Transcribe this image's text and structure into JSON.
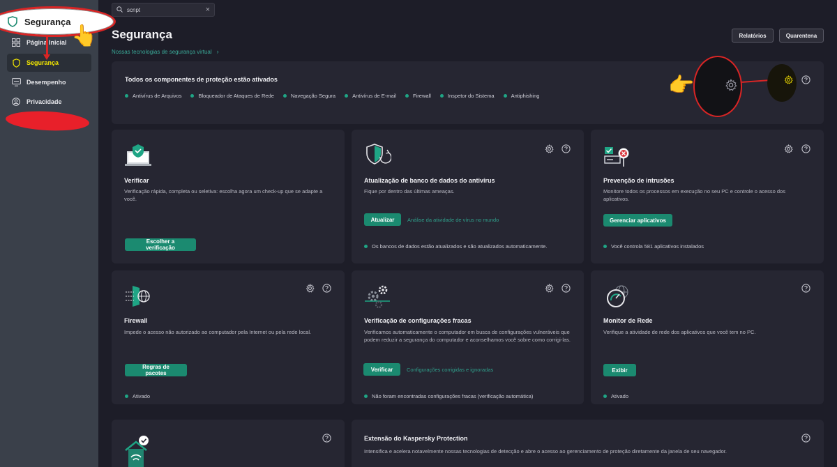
{
  "sidebar": {
    "items": [
      {
        "label": "Página Inicial",
        "icon": "grid-icon"
      },
      {
        "label": "Segurança",
        "icon": "shield-icon",
        "active": true
      },
      {
        "label": "Desempenho",
        "icon": "monitor-icon"
      },
      {
        "label": "Privacidade",
        "icon": "privacy-icon"
      }
    ]
  },
  "brand": {
    "label": "Segurança"
  },
  "search": {
    "query": "scnpt"
  },
  "header": {
    "title": "Segurança",
    "subtitle_link": "Nossas tecnologias de segurança virtual",
    "reports_label": "Relatórios",
    "quarantine_label": "Quarentena"
  },
  "protection": {
    "title": "Todos os componentes de proteção estão ativados",
    "components": [
      "Antivírus de Arquivos",
      "Bloqueador de Ataques de Rede",
      "Navegação Segura",
      "Antivírus de E-mail",
      "Firewall",
      "Inspetor do Sistema",
      "Antiphishing"
    ]
  },
  "cards": {
    "scan": {
      "title": "Verificar",
      "desc": "Verificação rápida, completa ou seletiva: escolha agora um check-up que se adapte a você.",
      "button": "Escolher a verificação"
    },
    "update": {
      "title": "Atualização de banco de dados do antivírus",
      "desc": "Fique por dentro das últimas ameaças.",
      "button": "Atualizar",
      "link": "Análise da atividade de vírus no mundo",
      "status": "Os bancos de dados estão atualizados e são atualizados automaticamente."
    },
    "intrusion": {
      "title": "Prevenção de intrusões",
      "desc": "Monitore todos os processos em execução no seu PC e controle o acesso dos aplicativos.",
      "button": "Gerenciar aplicativos",
      "status": "Você controla 581 aplicativos instalados"
    },
    "firewall": {
      "title": "Firewall",
      "desc": "Impede o acesso não autorizado ao computador pela Internet ou pela rede local.",
      "button": "Regras de pacotes",
      "status": "Ativado"
    },
    "weak": {
      "title": "Verificação de configurações fracas",
      "desc": "Verificamos automaticamente o computador em busca de configurações vulneráveis que podem reduzir a segurança do computador e aconselhamos você sobre como corrigi-las.",
      "button": "Verificar",
      "link": "Configurações corrigidas e ignoradas",
      "status": "Não foram encontradas configurações fracas (verificação automática)"
    },
    "network": {
      "title": "Monitor de Rede",
      "desc": "Verifique a atividade de rede dos aplicativos que você tem no PC.",
      "button": "Exibir",
      "status": "Ativado"
    },
    "extension": {
      "title": "Extensão do Kaspersky Protection",
      "desc": "Intensifica e acelera notavelmente nossas tecnologias de detecção e abre o acesso ao gerenciamento de proteção diretamente da janela de seu navegador."
    }
  },
  "colors": {
    "accent": "#1b8a70",
    "active_nav": "#f2e600",
    "annotation": "#d92525"
  }
}
